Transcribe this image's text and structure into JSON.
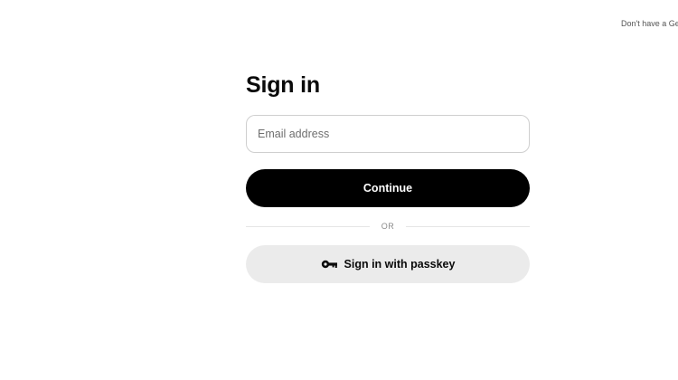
{
  "header": {
    "signup_prompt": "Don't have a Ge"
  },
  "signin": {
    "title": "Sign in",
    "email_placeholder": "Email address",
    "continue_label": "Continue",
    "divider_text": "OR",
    "passkey_label": "Sign in with passkey",
    "passkey_icon": "key-icon"
  },
  "colors": {
    "primary_button_bg": "#000000",
    "primary_button_text": "#ffffff",
    "secondary_button_bg": "#ebebeb",
    "input_border": "#cfcfcf",
    "divider_line": "#e6e6e6"
  }
}
